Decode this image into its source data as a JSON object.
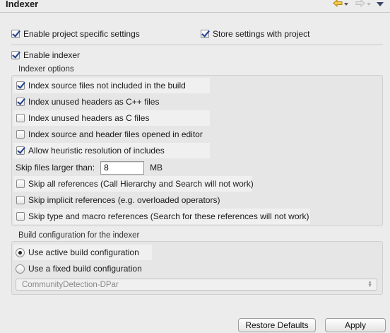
{
  "header": {
    "title": "Indexer"
  },
  "top_settings": {
    "enable_project_specific": {
      "label": "Enable project specific settings",
      "checked": true
    },
    "store_settings": {
      "label": "Store settings with project",
      "checked": true
    }
  },
  "enable_indexer": {
    "label": "Enable indexer",
    "checked": true
  },
  "indexer_options": {
    "title": "Indexer options",
    "items": [
      {
        "label": "Index source files not included in the build",
        "checked": true
      },
      {
        "label": "Index unused headers as C++ files",
        "checked": true
      },
      {
        "label": "Index unused headers as C files",
        "checked": false
      },
      {
        "label": "Index source and header files opened in editor",
        "checked": false
      },
      {
        "label": "Allow heuristic resolution of includes",
        "checked": true
      }
    ],
    "skip_files": {
      "label": "Skip files larger than:",
      "value": "8",
      "unit": "MB"
    },
    "skip_items": [
      {
        "label": "Skip all references (Call Hierarchy and Search will not work)",
        "checked": false
      },
      {
        "label": "Skip implicit references (e.g. overloaded operators)",
        "checked": false
      },
      {
        "label": "Skip type and macro references (Search for these references will not work)",
        "checked": false
      }
    ]
  },
  "build_config": {
    "title": "Build configuration for the indexer",
    "options": [
      {
        "label": "Use active build configuration",
        "selected": true
      },
      {
        "label": "Use a fixed build configuration",
        "selected": false
      }
    ],
    "selected_config": "CommunityDetection-DPar"
  },
  "buttons": {
    "restore_defaults": "Restore Defaults",
    "apply": "Apply"
  }
}
